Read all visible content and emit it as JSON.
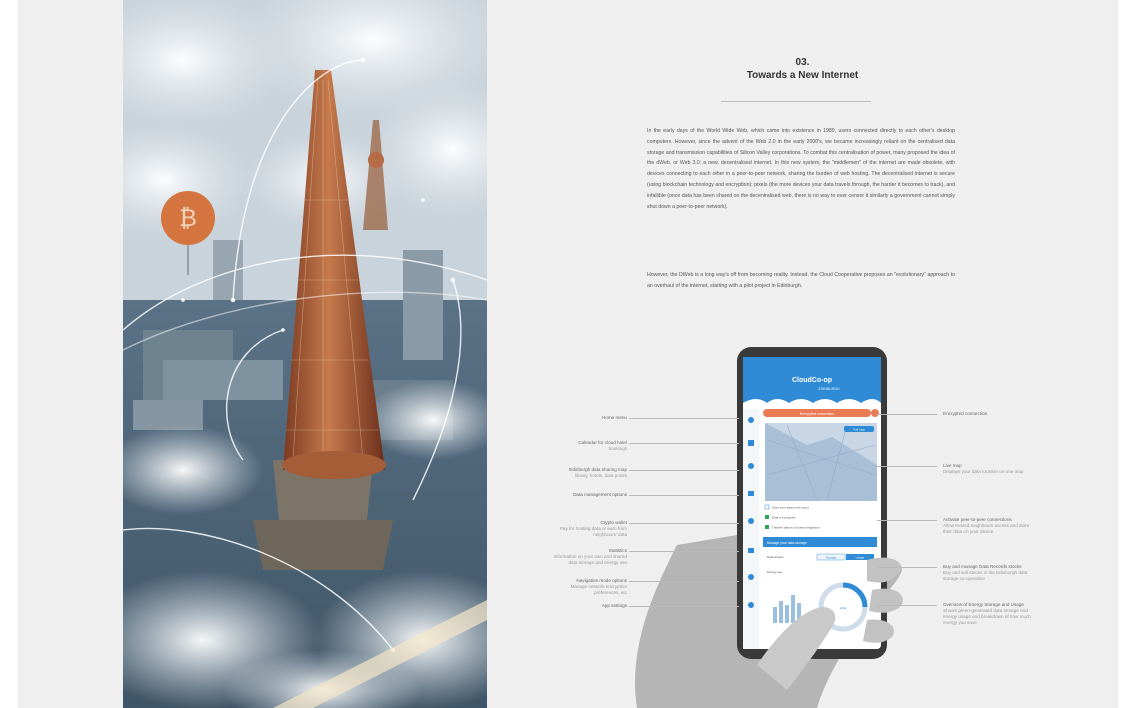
{
  "section": {
    "number": "03.",
    "title": "Towards a New Internet"
  },
  "paragraphs": [
    "In the early days of the World Wide Web, which came into existence in 1989, users connected directly to each other's desktop computers. However, since the advent of the Web 2.0 in the early 2000's, we became increasingly reliant on the centralised data storage and transmission capabilities of Silicon Valley corporations. To combat this centralisation of power, many proposed the idea of the dWeb, or Web 3.0: a new, decentralised internet. In this new system, the \"middlemen\" of the internet are made obsolete, with devices connecting to each other in a peer-to-peer network, sharing the burden of web hosting. The decentralised internet is secure (using blockchain technology and encryption): pixels (the more devices your data travels through, the harder it becomes to track), and infallible (once data has been shared on the decentralised web, there is no way to ever censor it similarly a government cannot simply shut down a peer-to-peer network).",
    "However, the DWeb is a long way's off from becoming reality. Instead, the Cloud Cooperative proposes an \"evolutionary\" approach to an overhaul of the internet, starting with a pilot project in Edinburgh."
  ],
  "phone": {
    "app_title": "CloudCo-op",
    "app_subtitle": "EDINBURGH",
    "alert_text": "Encrypted connection",
    "map_button": "Full map",
    "checkbox_1": "Store your data in the cloud",
    "checkbox_2": "Data is encrypted",
    "checkbox_3": "Transfer data to a trusted neighbour",
    "storage_button": "Manage your data storage",
    "row_label": "Data shared",
    "seg_1": "Storage",
    "seg_2": "Usage",
    "usage_label": "Energy use",
    "overlay_label": "LIVE"
  },
  "labels_left": [
    {
      "title": "Home menu",
      "sub": ""
    },
    {
      "title": "Calendar for cloud hotel",
      "sub": "bookings"
    },
    {
      "title": "Edinburgh data sharing map",
      "sub": "library, hotels, data points"
    },
    {
      "title": "Data management options",
      "sub": ""
    },
    {
      "title": "Crypto wallet",
      "sub": "Pay for hosting data or earn from neighbours' data"
    },
    {
      "title": "Statistics",
      "sub": "Information on your own and shared data storage and energy use"
    },
    {
      "title": "Navigation mode options",
      "sub": "Manage network encryption preferences, etc"
    },
    {
      "title": "App settings",
      "sub": ""
    }
  ],
  "labels_right": [
    {
      "title": "Encrypted connection",
      "sub": ""
    },
    {
      "title": "Live map",
      "sub": "Displays your data location on one map"
    },
    {
      "title": "Activate peer-to-peer connections",
      "sub": "Allow trusted neighbours access and store their data on your device"
    },
    {
      "title": "Buy and manage Data Records stocks",
      "sub": "Buy and sell stocks in the Edinburgh data storage co-operative"
    },
    {
      "title": "Overview of Energy Storage and Usage",
      "sub": "Shows green-generated data storage and energy usage and breakdown of how much energy you save"
    }
  ],
  "colors": {
    "app_blue": "#2f8bd6",
    "alert_orange": "#ea7c55",
    "page_bg": "#efefef",
    "text_gray": "#555555"
  }
}
